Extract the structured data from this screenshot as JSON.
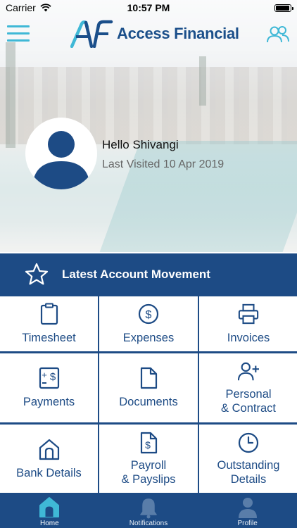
{
  "status_bar": {
    "carrier": "Carrier",
    "time": "10:57 PM",
    "battery_level": 0.95
  },
  "header": {
    "logo_text": "Access Financial",
    "logo_mark": "AF"
  },
  "profile": {
    "greeting": "Hello Shivangi",
    "last_visited": "Last Visited 10 Apr 2019"
  },
  "latest": {
    "label": "Latest Account Movement"
  },
  "tiles": [
    {
      "label": "Timesheet",
      "icon": "clipboard-icon"
    },
    {
      "label": "Expenses",
      "icon": "dollar-circle-icon"
    },
    {
      "label": "Invoices",
      "icon": "printer-icon"
    },
    {
      "label": "Payments",
      "icon": "payment-calculator-icon"
    },
    {
      "label": "Documents",
      "icon": "document-icon"
    },
    {
      "label": "Personal",
      "label2": "& Contract",
      "icon": "add-user-icon"
    },
    {
      "label": "Bank Details",
      "icon": "bank-icon"
    },
    {
      "label": "Payroll",
      "label2": "& Payslips",
      "icon": "payslip-icon"
    },
    {
      "label": "Outstanding",
      "label2": "Details",
      "icon": "clock-icon"
    }
  ],
  "tabbar": {
    "home": "Home",
    "notifications": "Notifications",
    "profile": "Profile"
  },
  "colors": {
    "primary": "#1d4b85",
    "accent": "#3fb8d6",
    "tile_bg": "#ffffff"
  }
}
